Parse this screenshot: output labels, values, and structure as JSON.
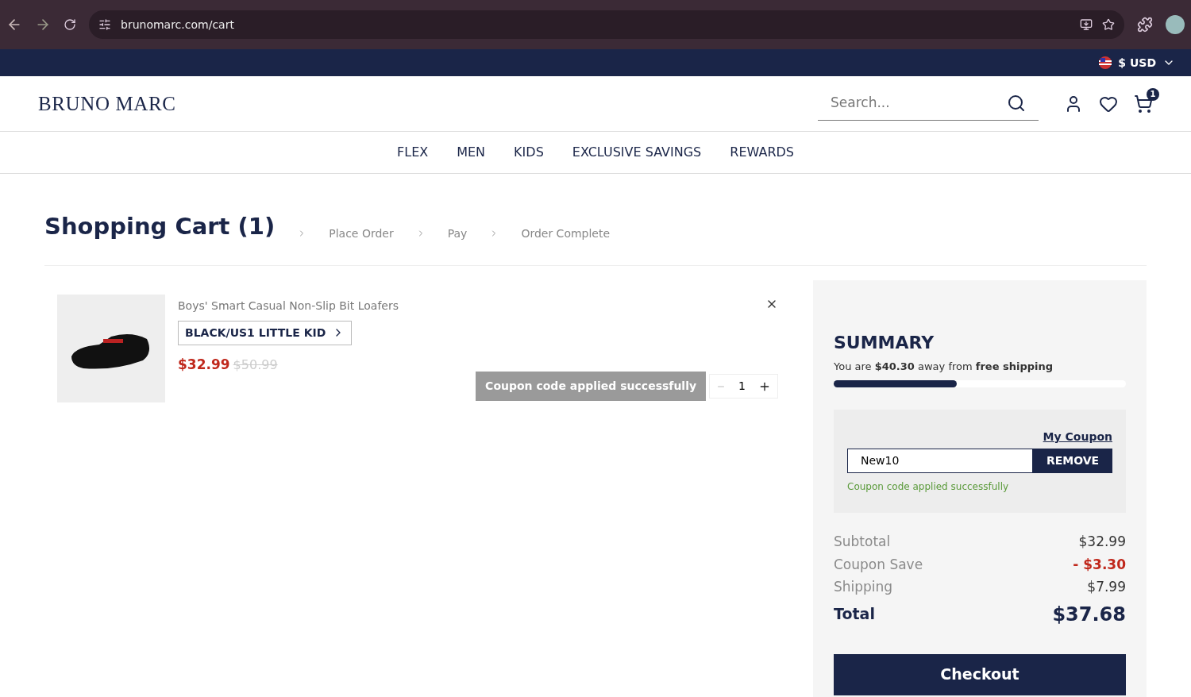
{
  "browser": {
    "url": "brunomarc.com/cart"
  },
  "top_bar": {
    "currency": "$ USD"
  },
  "header": {
    "logo": "BRUNO MARC",
    "search": {
      "placeholder": "Search..."
    },
    "cart_count": "1"
  },
  "nav": [
    "FLEX",
    "MEN",
    "KIDS",
    "EXCLUSIVE SAVINGS",
    "REWARDS"
  ],
  "steps": [
    {
      "label": "Shopping Cart (1)",
      "selected": true
    },
    {
      "label": "Place Order",
      "selected": false
    },
    {
      "label": "Pay",
      "selected": false
    },
    {
      "label": "Order Complete",
      "selected": false
    }
  ],
  "cart_items": [
    {
      "name": "Boys' Smart Casual Non-Slip Bit Loafers",
      "variant": "BLACK/US1 LITTLE KID",
      "price": "$32.99",
      "old_price": "$50.99",
      "quantity": "1"
    }
  ],
  "toast": "Coupon code applied successfully",
  "summary": {
    "title": "SUMMARY",
    "free_shipping": "You are **$40.30** away from **free shipping**",
    "level": 0.42,
    "coupon": {
      "link": "My Coupon",
      "value": "New10",
      "button": "REMOVE",
      "message": "Coupon code applied successfully"
    },
    "lines": [
      {
        "label": "Subtotal",
        "value": "$32.99",
        "kind": "normal"
      },
      {
        "label": "Coupon Save",
        "value": "- $3.30",
        "kind": "discount"
      },
      {
        "label": "Shipping",
        "value": "$7.99",
        "kind": "normal"
      },
      {
        "label": "Total",
        "value": "$37.68",
        "kind": "total"
      }
    ],
    "checkout": "Checkout"
  }
}
